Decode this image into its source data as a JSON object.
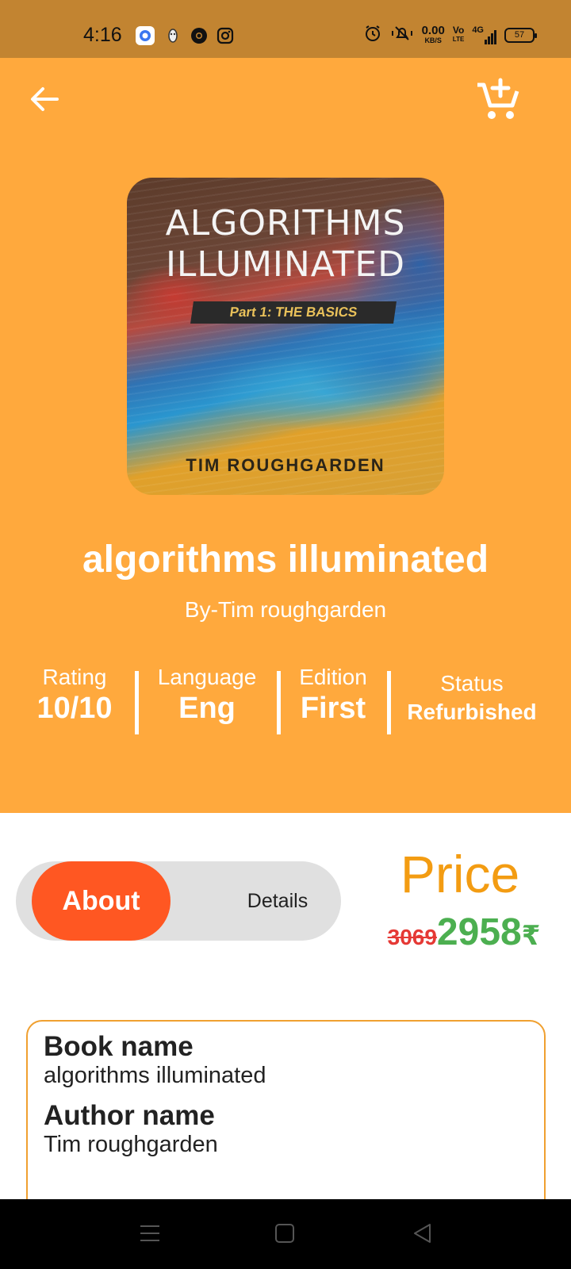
{
  "status_bar": {
    "time": "4:16",
    "net_speed": "0.00",
    "net_unit": "KB/S",
    "volte_top": "Vo",
    "volte_bottom": "LTE",
    "network": "4G",
    "battery": "57",
    "icons": [
      "signal-app-icon",
      "vpn-icon",
      "chrome-icon",
      "instagram-icon",
      "alarm-icon",
      "mute-icon",
      "signal-icon"
    ]
  },
  "header": {
    "back_icon": "arrow-left-icon",
    "cart_icon": "add-to-cart-icon"
  },
  "cover": {
    "title": "ALGORITHMS ILLUMINATED",
    "subtitle": "Part 1: THE BASICS",
    "author": "TIM ROUGHGARDEN"
  },
  "book": {
    "title": "algorithms illuminated",
    "author_line": "By-Tim roughgarden"
  },
  "stats": [
    {
      "label": "Rating",
      "value": "10/10"
    },
    {
      "label": "Language",
      "value": "Eng"
    },
    {
      "label": "Edition",
      "value": "First"
    },
    {
      "label": "Status",
      "value": "Refurbished"
    }
  ],
  "tabs": {
    "about": "About",
    "details": "Details",
    "active": "About"
  },
  "price": {
    "label": "Price",
    "old": "3069",
    "new": "2958",
    "currency": "₹"
  },
  "info": {
    "book_name_label": "Book name",
    "book_name": "algorithms illuminated",
    "author_name_label": "Author name",
    "author_name": "Tim roughgarden"
  },
  "colors": {
    "hero_bg": "#ffa93d",
    "status_bg": "#c28431",
    "accent": "#ff5722",
    "price_label": "#f39c12",
    "price_new": "#4caf50",
    "price_old": "#e53935"
  },
  "nav": [
    "menu-icon",
    "home-icon",
    "back-triangle-icon"
  ]
}
